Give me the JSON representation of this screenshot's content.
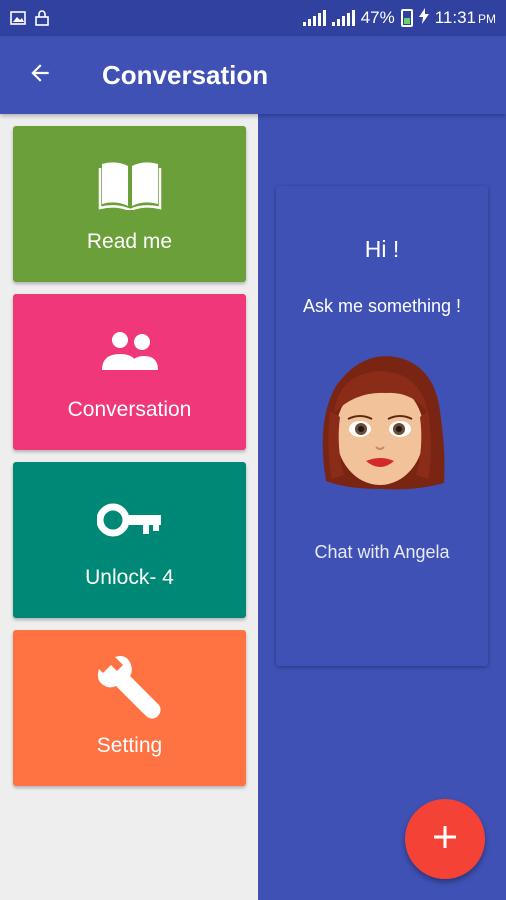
{
  "status_bar": {
    "battery": "47%",
    "time": "11:31",
    "ampm": "PM",
    "icons": [
      "image-icon",
      "lock-icon",
      "signal-icon",
      "signal-icon",
      "battery-icon",
      "charging-icon"
    ]
  },
  "app_bar": {
    "title": "Conversation",
    "back_icon": "arrow-left-icon"
  },
  "menu": {
    "tiles": [
      {
        "label": "Read me",
        "icon": "book-icon",
        "color": "#6A9F3A"
      },
      {
        "label": "Conversation",
        "icon": "people-icon",
        "color": "#F03779"
      },
      {
        "label": "Unlock- 4",
        "icon": "key-icon",
        "color": "#008877"
      },
      {
        "label": "Setting",
        "icon": "wrench-icon",
        "color": "#FF7242"
      }
    ]
  },
  "chat_card": {
    "greeting": "Hi !",
    "prompt": "Ask me something !",
    "avatar_icon": "woman-face-icon",
    "link": "Chat with Angela"
  },
  "fab": {
    "icon": "plus-icon",
    "color": "#F44336"
  },
  "colors": {
    "primary": "#3F51B5",
    "primary_dark": "#3041A0",
    "panel_bg": "#EEEEEE"
  }
}
